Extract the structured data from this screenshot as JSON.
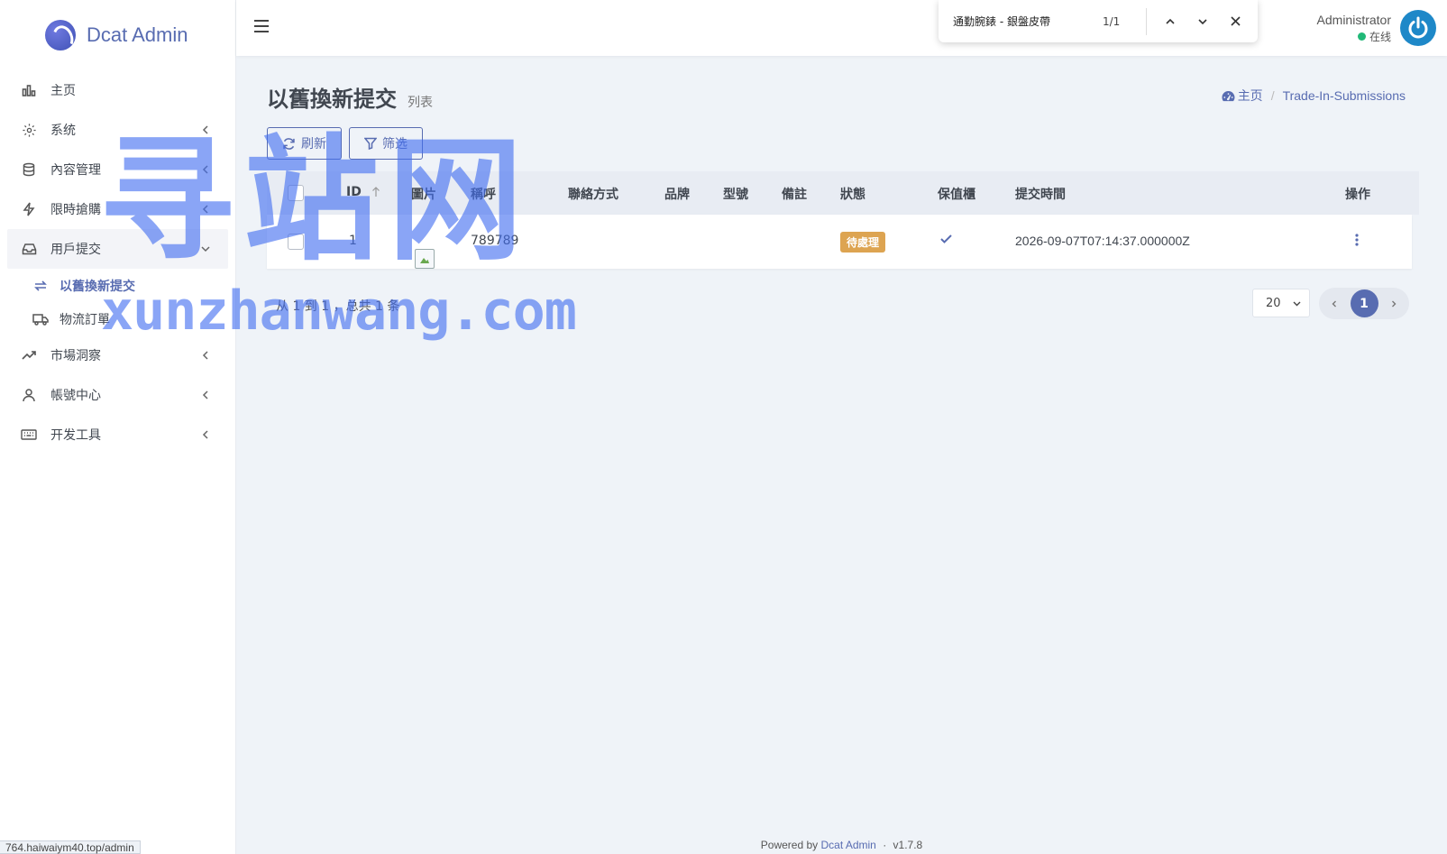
{
  "sidebar": {
    "logo_text": "Dcat Admin",
    "items": [
      {
        "label": "主页"
      },
      {
        "label": "系统"
      },
      {
        "label": "內容管理"
      },
      {
        "label": "限時搶購"
      },
      {
        "label": "用戶提交"
      },
      {
        "label": "市場洞察"
      },
      {
        "label": "帳號中心"
      },
      {
        "label": "开发工具"
      }
    ],
    "sub_items": [
      {
        "label": "以舊換新提交"
      },
      {
        "label": "物流訂單"
      }
    ]
  },
  "status_bar_url": "764.haiwaiym40.top/admin",
  "findbar": {
    "query": "通勤腕錶 - 銀盤皮帶",
    "count": "1/1"
  },
  "user": {
    "name": "Administrator",
    "status": "在线"
  },
  "header": {
    "title": "以舊換新提交",
    "description": "列表"
  },
  "breadcrumb": {
    "home": "主页",
    "current": "Trade-In-Submissions"
  },
  "toolbar": {
    "refresh_label": "刷新",
    "filter_label": "筛选"
  },
  "table": {
    "columns": [
      "ID",
      "圖片",
      "稱呼",
      "聯絡方式",
      "品牌",
      "型號",
      "備註",
      "狀態",
      "保值櫃",
      "提交時間",
      "操作"
    ],
    "rows": [
      {
        "id": "1",
        "name": "789789",
        "contact": "",
        "brand": "",
        "model": "",
        "note": "",
        "status": "待處理",
        "vault": true,
        "submitted_at": "2026-09-07T07:14:37.000000Z"
      }
    ]
  },
  "pagination": {
    "info": "从 1 到 1 ，总共 1 条",
    "per_page": "20",
    "current_page": "1"
  },
  "footer": {
    "powered_by": "Powered by",
    "brand": "Dcat Admin",
    "separator": "·",
    "version": "v1.7.8"
  },
  "watermark": {
    "cn": "寻站网",
    "en": "xunzhanwang.com"
  },
  "colors": {
    "accent": "#586cb1",
    "badge_pending": "#dda451",
    "online": "#21b978",
    "background": "#eff3f8"
  }
}
